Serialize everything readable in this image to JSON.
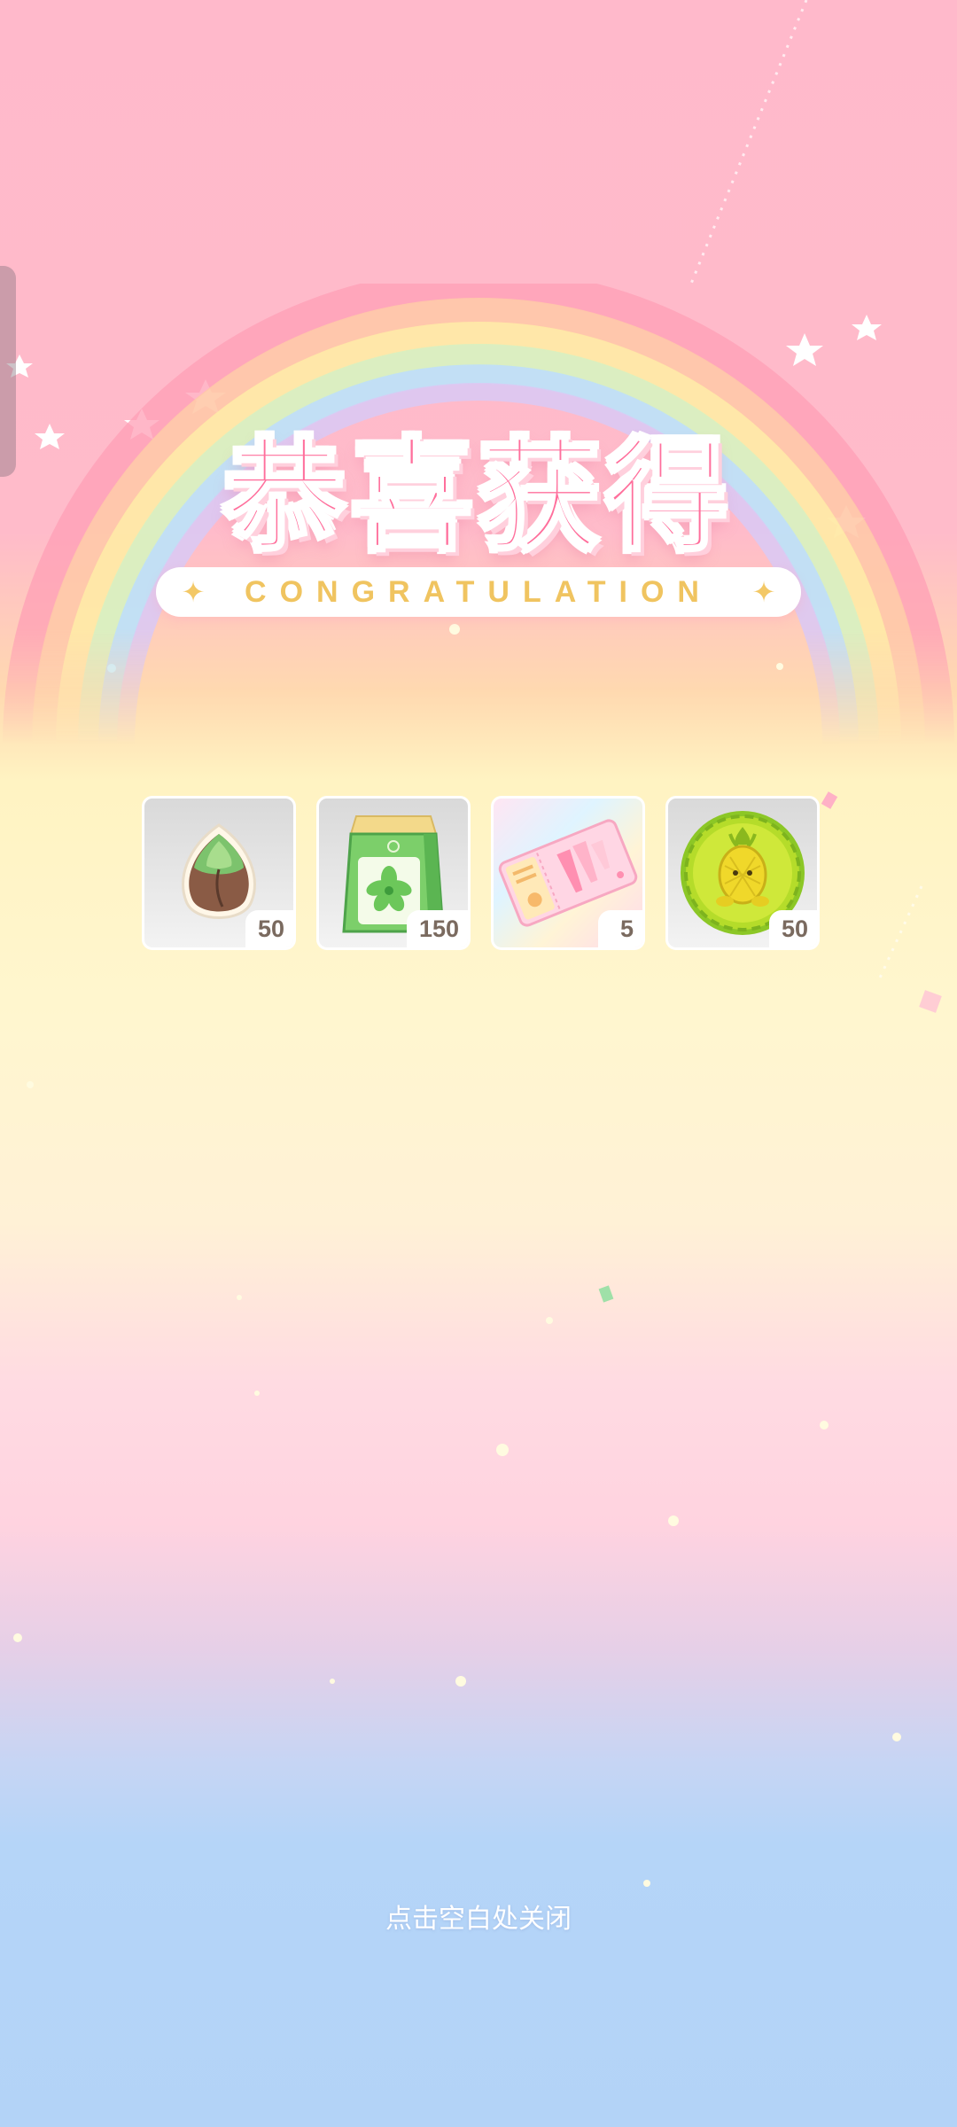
{
  "title": "恭喜获得",
  "subtitle": "CONGRATULATION",
  "rewards": [
    {
      "name": "seed-icon",
      "quantity": "50"
    },
    {
      "name": "fertilizer-bag-icon",
      "quantity": "150"
    },
    {
      "name": "ticket-icon",
      "quantity": "5"
    },
    {
      "name": "pineapple-coin-icon",
      "quantity": "50"
    }
  ],
  "close_hint": "点击空白处关闭",
  "colors": {
    "title": "#ff6f9c",
    "subtitle": "#f0c460",
    "background_top": "#ffb9cb",
    "background_bottom": "#b3d3f7"
  }
}
